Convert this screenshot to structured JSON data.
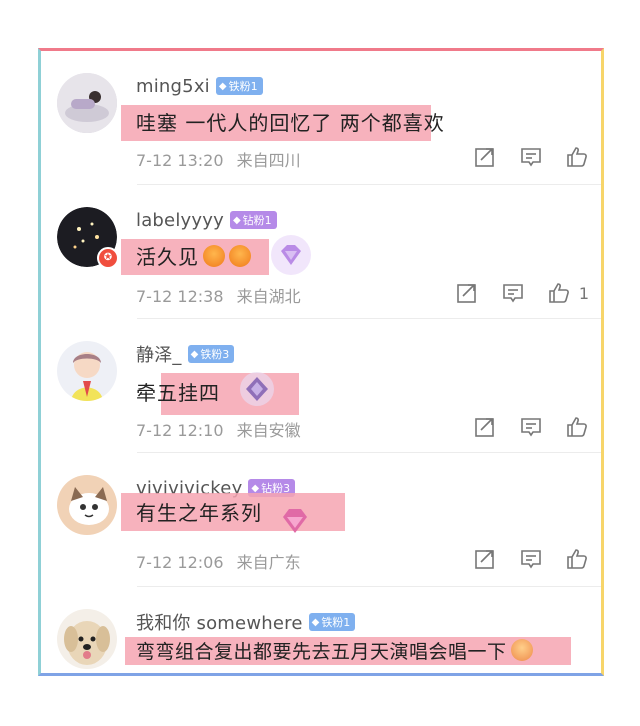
{
  "comments": [
    {
      "username": "ming5xi",
      "badge": "铁粉1",
      "badge_color": "#7fb0ef",
      "text": "哇塞 一代人的回忆了 两个都喜欢",
      "date": "7-12 13:20",
      "location": "来自四川",
      "likes": ""
    },
    {
      "username": "labelyyyy",
      "badge": "钻粉1",
      "badge_color": "#b58ae8",
      "text": "活久见",
      "date": "7-12 12:38",
      "location": "来自湖北",
      "likes": "1"
    },
    {
      "username": "静泽_",
      "badge": "铁粉3",
      "badge_color": "#7fb0ef",
      "text": "牵五挂四",
      "date": "7-12 12:10",
      "location": "来自安徽",
      "likes": ""
    },
    {
      "username": "vivivivickey",
      "badge": "钻粉3",
      "badge_color": "#b58ae8",
      "text": "有生之年系列",
      "date": "7-12 12:06",
      "location": "来自广东",
      "likes": ""
    },
    {
      "username": "我和你 somewhere",
      "badge": "铁粉1",
      "badge_color": "#7fb0ef",
      "text": "弯弯组合复出都要先去五月天演唱会唱一下",
      "date": "",
      "location": "",
      "likes": ""
    }
  ],
  "icons": {
    "share": "share-icon",
    "comment": "comment-icon",
    "like": "thumbs-up-icon",
    "badge_gem": "diamond-icon"
  },
  "colors": {
    "highlight": "#f6a5b2",
    "border_top": "#f07a8a",
    "border_right": "#f7d56a",
    "border_bottom": "#7fa3e6",
    "border_left": "#8fd0d6"
  }
}
